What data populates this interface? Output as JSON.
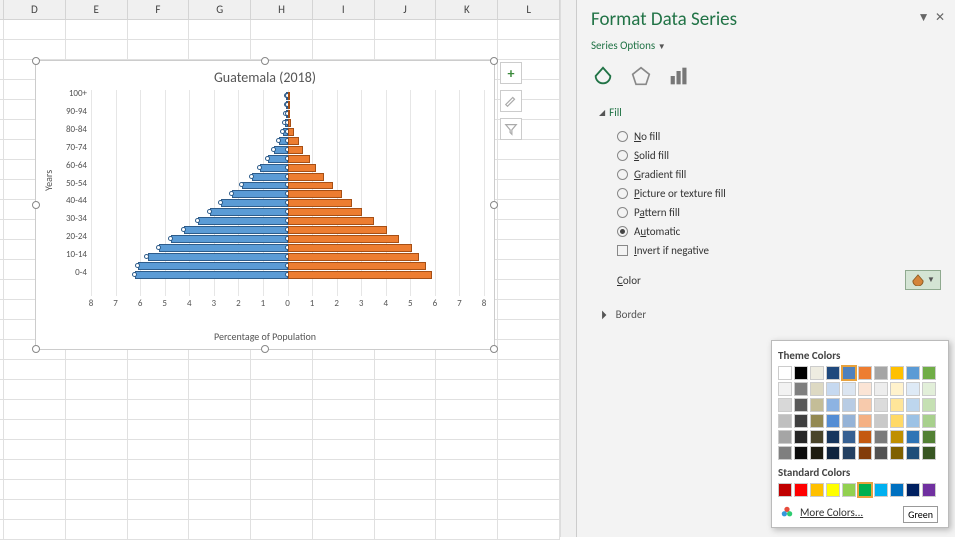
{
  "columns": [
    "D",
    "E",
    "F",
    "G",
    "H",
    "I",
    "J",
    "K",
    "L"
  ],
  "chart_data": {
    "type": "bar",
    "title": "Guatemala (2018)",
    "y_title": "Years",
    "x_title": "Percentage of Population",
    "x_ticks": [
      8,
      7,
      6,
      5,
      4,
      3,
      2,
      1,
      0,
      1,
      2,
      3,
      4,
      5,
      6,
      7,
      8
    ],
    "categories": [
      "100+",
      "",
      "90-94",
      "",
      "80-84",
      "",
      "70-74",
      "",
      "60-64",
      "",
      "50-54",
      "",
      "40-44",
      "",
      "30-34",
      "",
      "20-24",
      "",
      "10-14",
      "",
      "0-4"
    ],
    "left_values": [
      0.02,
      0.03,
      0.05,
      0.1,
      0.2,
      0.35,
      0.55,
      0.8,
      1.1,
      1.45,
      1.85,
      2.25,
      2.7,
      3.15,
      3.65,
      4.2,
      4.75,
      5.25,
      5.7,
      6.1,
      6.2
    ],
    "right_values": [
      0.02,
      0.04,
      0.08,
      0.15,
      0.28,
      0.45,
      0.65,
      0.92,
      1.18,
      1.5,
      1.85,
      2.22,
      2.62,
      3.05,
      3.52,
      4.05,
      4.55,
      5.05,
      5.35,
      5.65,
      5.9
    ]
  },
  "chart_buttons": {
    "plus": "+"
  },
  "pane": {
    "title": "Format Data Series",
    "sub": "Series Options",
    "fill": {
      "header": "Fill",
      "no_fill": "No fill",
      "solid_fill": "Solid fill",
      "gradient_fill": "Gradient fill",
      "picture_fill": "Picture or texture fill",
      "pattern_fill": "Pattern fill",
      "automatic": "Automatic",
      "invert": "Invert if negative",
      "color": "Color"
    },
    "border_header": "Border"
  },
  "popup": {
    "theme_label": "Theme Colors",
    "theme_row1": [
      "#ffffff",
      "#000000",
      "#eeece1",
      "#1f497d",
      "#4f81bd",
      "#ed7d31",
      "#a5a5a5",
      "#ffc000",
      "#5b9bd5",
      "#70ad47"
    ],
    "theme_shades": [
      [
        "#f2f2f2",
        "#7f7f7f",
        "#ddd9c3",
        "#c6d9f0",
        "#dbe5f1",
        "#fbe4d5",
        "#ededed",
        "#fff2cc",
        "#deeaf6",
        "#e2efd9"
      ],
      [
        "#d8d8d8",
        "#595959",
        "#c4bd97",
        "#8db3e2",
        "#b8cce4",
        "#f7caac",
        "#dbdbdb",
        "#ffe599",
        "#bdd6ee",
        "#c5e0b3"
      ],
      [
        "#bfbfbf",
        "#3f3f3f",
        "#938953",
        "#548dd4",
        "#95b3d7",
        "#f4b083",
        "#c9c9c9",
        "#ffd966",
        "#9cc2e5",
        "#a8d08d"
      ],
      [
        "#a5a5a5",
        "#262626",
        "#494429",
        "#17365d",
        "#366092",
        "#c45911",
        "#7b7b7b",
        "#bf8f00",
        "#2e74b5",
        "#538135"
      ],
      [
        "#7f7f7f",
        "#0c0c0c",
        "#1d1b10",
        "#0f243e",
        "#244061",
        "#833c0b",
        "#525252",
        "#7f6000",
        "#1f4e79",
        "#385623"
      ]
    ],
    "standard_label": "Standard Colors",
    "standard": [
      "#c00000",
      "#ff0000",
      "#ffc000",
      "#ffff00",
      "#92d050",
      "#00b050",
      "#00b0f0",
      "#0070c0",
      "#002060",
      "#7030a0"
    ],
    "selected_standard": 5,
    "more": "More Colors...",
    "tooltip": "Green"
  }
}
